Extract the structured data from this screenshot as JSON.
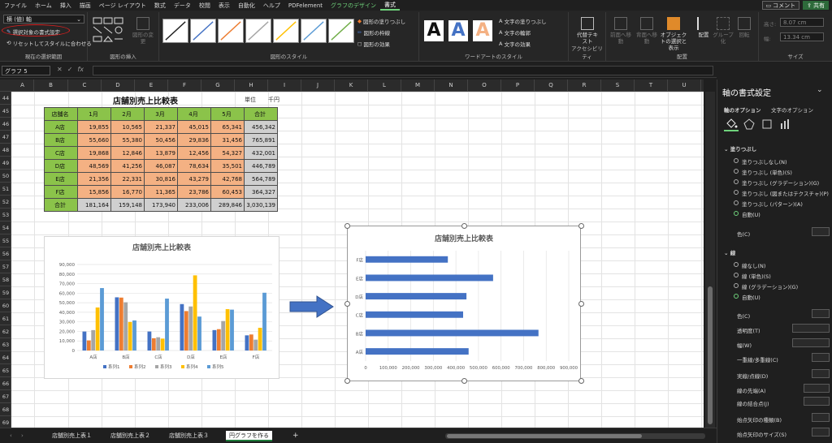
{
  "menu": {
    "items": [
      "ファイル",
      "ホーム",
      "挿入",
      "描画",
      "ページ レイアウト",
      "数式",
      "データ",
      "校閲",
      "表示",
      "自動化",
      "ヘルプ",
      "PDFelement",
      "グラフのデザイン",
      "書式"
    ],
    "comment_label": "コメント",
    "share_label": "共有"
  },
  "ribbon": {
    "selection_value": "横 (値) 軸",
    "format_selection": "選択対象の書式設定",
    "reset_style": "リセットしてスタイルに合わせる",
    "group_current_selection": "現在の選択範囲",
    "shape_change": "図形の変更",
    "group_insert_shapes": "図形の挿入",
    "group_shape_styles": "図形のスタイル",
    "shape_fill": "図形の塗りつぶし",
    "shape_outline": "図形の枠線",
    "shape_effects": "図形の効果",
    "wordart_letter": "A",
    "text_fill": "文字の塗りつぶし",
    "text_outline": "文字の輪郭",
    "text_effects": "文字の効果",
    "group_wordart_styles": "ワードアートのスタイル",
    "alt_text": "代替テキスト",
    "group_accessibility": "アクセシビリティ",
    "bring_forward": "前面へ移動",
    "send_backward": "背面へ移動",
    "selection_pane": "オブジェクトの選択と表示",
    "align": "配置",
    "group": "グループ化",
    "rotate": "回転",
    "group_arrange": "配置",
    "height_label": "高さ:",
    "height_value": "8.07 cm",
    "width_label": "幅:",
    "width_value": "13.34 cm",
    "group_size": "サイズ"
  },
  "formula": {
    "name_box": "グラフ 5",
    "fx_label": "fx"
  },
  "grid": {
    "columns": [
      "A",
      "B",
      "C",
      "D",
      "E",
      "F",
      "G",
      "H",
      "I",
      "J",
      "K",
      "L",
      "M",
      "N",
      "O",
      "P",
      "Q",
      "R",
      "S",
      "T",
      "U"
    ],
    "rows": [
      "44",
      "45",
      "46",
      "47",
      "48",
      "49",
      "50",
      "51",
      "52",
      "53",
      "54",
      "55",
      "56",
      "57",
      "58",
      "59",
      "60",
      "61",
      "62",
      "63",
      "64",
      "65",
      "66",
      "67",
      "68",
      "69"
    ]
  },
  "table": {
    "title": "店舗別売上比較表",
    "unit_label": "単位",
    "unit_value": "千円",
    "header": [
      "店舗名",
      "1月",
      "2月",
      "3月",
      "4月",
      "5月",
      "合計"
    ],
    "rows": [
      [
        "A店",
        "19,855",
        "10,565",
        "21,337",
        "45,015",
        "65,341",
        "456,342"
      ],
      [
        "B店",
        "55,660",
        "55,380",
        "50,456",
        "29,836",
        "31,456",
        "765,891"
      ],
      [
        "C店",
        "19,868",
        "12,846",
        "13,879",
        "12,456",
        "54,327",
        "432,001"
      ],
      [
        "D店",
        "48,569",
        "41,256",
        "46,087",
        "78,634",
        "35,501",
        "446,789"
      ],
      [
        "E店",
        "21,356",
        "22,331",
        "30,816",
        "43,279",
        "42,768",
        "564,789"
      ],
      [
        "F店",
        "15,856",
        "16,770",
        "11,365",
        "23,786",
        "60,453",
        "364,327"
      ],
      [
        "合計",
        "181,164",
        "159,148",
        "173,940",
        "233,006",
        "289,846",
        "3,030,139"
      ]
    ]
  },
  "chart_data": [
    {
      "type": "bar",
      "title": "店舗別売上比較表",
      "categories": [
        "A店",
        "B店",
        "C店",
        "D店",
        "E店",
        "F店"
      ],
      "ylim": [
        0,
        90000
      ],
      "yticks": [
        "0",
        "10,000",
        "20,000",
        "30,000",
        "40,000",
        "50,000",
        "60,000",
        "70,000",
        "80,000",
        "90,000"
      ],
      "series": [
        {
          "name": "系列1",
          "color": "#4472c4",
          "values": [
            19855,
            55660,
            19868,
            48569,
            21356,
            15856
          ]
        },
        {
          "name": "系列2",
          "color": "#ed7d31",
          "values": [
            10565,
            55380,
            12846,
            41256,
            22331,
            16770
          ]
        },
        {
          "name": "系列3",
          "color": "#a5a5a5",
          "values": [
            21337,
            50456,
            13879,
            46087,
            30816,
            11365
          ]
        },
        {
          "name": "系列4",
          "color": "#ffc000",
          "values": [
            45015,
            29836,
            12456,
            78634,
            43279,
            23786
          ]
        },
        {
          "name": "系列5",
          "color": "#5b9bd5",
          "values": [
            65341,
            31456,
            54327,
            35501,
            42768,
            60453
          ]
        }
      ],
      "legend": "bottom",
      "grid": true
    },
    {
      "type": "bar",
      "orientation": "horizontal",
      "title": "店舗別売上比較表",
      "categories": [
        "A店",
        "B店",
        "C店",
        "D店",
        "E店",
        "F店"
      ],
      "xlim": [
        0,
        900000
      ],
      "xticks": [
        "0",
        "100,000",
        "200,000",
        "300,000",
        "400,000",
        "500,000",
        "600,000",
        "700,000",
        "800,000",
        "900,000"
      ],
      "series": [
        {
          "color": "#4472c4",
          "values": [
            456342,
            765891,
            432001,
            446789,
            564789,
            364327
          ]
        }
      ],
      "grid": true
    }
  ],
  "pane": {
    "title": "軸の書式設定",
    "tab_axis_options": "軸のオプション",
    "tab_text_options": "文字のオプション",
    "section_fill": "塗りつぶし",
    "fill_options": [
      "塗りつぶしなし(N)",
      "塗りつぶし (単色)(S)",
      "塗りつぶし (グラデーション)(G)",
      "塗りつぶし (図またはテクスチャ)(P)",
      "塗りつぶし (パターン)(A)",
      "自動(U)"
    ],
    "color_label": "色(C)",
    "section_line": "線",
    "line_options": [
      "線なし(N)",
      "線 (単色)(S)",
      "線 (グラデーション)(G)",
      "自動(U)"
    ],
    "line_color_label": "色(C)",
    "transparency_label": "透明度(T)",
    "width_label": "幅(W)",
    "compound_label": "一重線/多重線(C)",
    "dash_label": "実線/点線(D)",
    "cap_label": "線の先端(A)",
    "join_label": "線の結合点(J)",
    "begin_arrow_type": "始点矢印の種類(B)",
    "begin_arrow_size": "始点矢印のサイズ(S)"
  },
  "sheets": {
    "tabs": [
      "店舗別売上表１",
      "店舗別売上表２",
      "店舗別売上表３",
      "円グラフを作る"
    ],
    "active_index": 3,
    "add_label": "+"
  },
  "colors": {
    "accent_green": "#6fd27b",
    "header_green": "#8bc34a",
    "value_orange": "#f4b183",
    "bar_blue": "#4472c4",
    "arrow_blue": "#4472c4",
    "annotation_red": "#d81f1f"
  }
}
